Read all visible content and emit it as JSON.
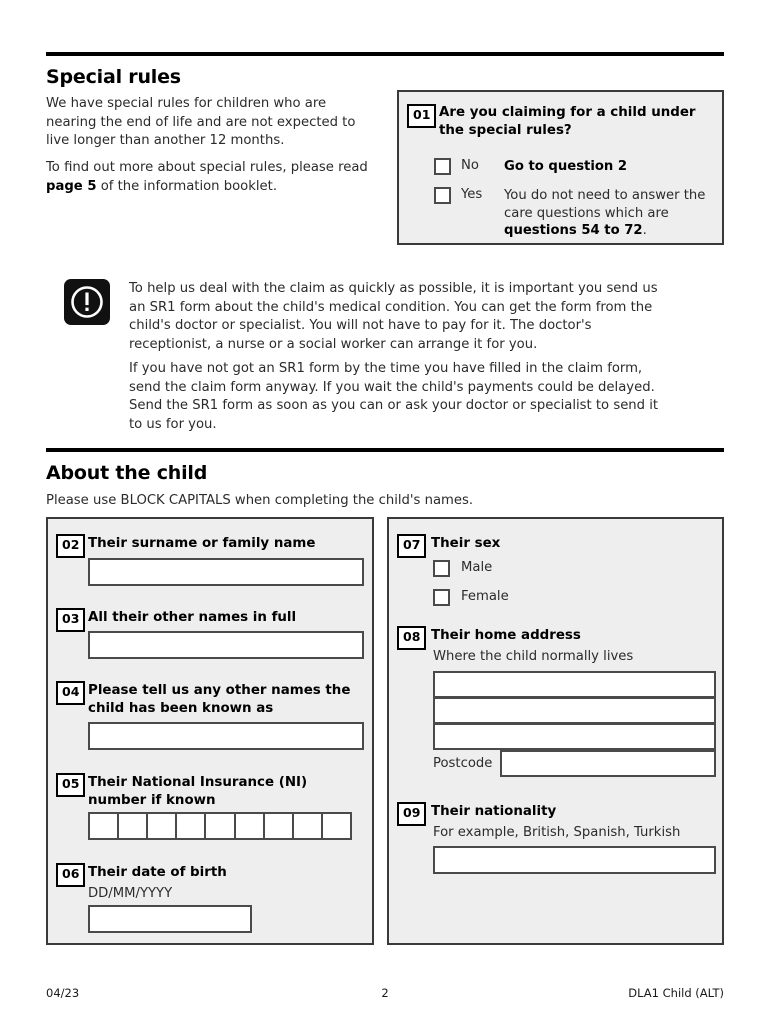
{
  "document": {
    "form_code": "DLA1 Child (ALT)",
    "page_number": "2",
    "revision_date": "04/23"
  },
  "section_special_rules": {
    "heading": "Special rules",
    "paragraph_1": "We have special rules for children who are nearing the end of life and are not expected to live longer than another 12 months.",
    "paragraph_2_before": "To find out more about special rules, please read ",
    "paragraph_2_bold": "page 5",
    "paragraph_2_after": " of the information booklet."
  },
  "question_01": {
    "number": "01",
    "label": "Are you claiming for a child under the special rules?",
    "options": [
      {
        "checkbox_label": "No",
        "note_text": "Go to question 2",
        "note_bold": true
      },
      {
        "checkbox_label": "Yes",
        "note_before": "You do not need to answer the care questions which are ",
        "note_bold_text": "questions 54 to 72",
        "note_after": "."
      }
    ]
  },
  "notice": {
    "icon": "exclamation-mark-icon",
    "paragraph_1": "To help us deal with the claim as quickly as possible, it is important you send us an SR1 form about the child's medical condition. You can get the form from the child's doctor or specialist. You will not have to pay for it. The doctor's receptionist, a nurse or a social worker can arrange it for you.",
    "paragraph_2": "If you have not got an SR1 form by the time you have filled in the claim form, send the claim form anyway. If you wait the child's payments could be delayed. Send the SR1 form as soon as you can or ask your doctor or specialist to send it to us for you."
  },
  "section_about_child": {
    "heading": "About the child",
    "instruction": "Please use BLOCK CAPITALS when completing the child's names."
  },
  "question_02": {
    "number": "02",
    "label": "Their surname or family name",
    "value": ""
  },
  "question_03": {
    "number": "03",
    "label": "All their other names in full",
    "value": ""
  },
  "question_04": {
    "number": "04",
    "label": "Please tell us any other names the child has been known as",
    "value": ""
  },
  "question_05": {
    "number": "05",
    "label": "Their National Insurance (NI) number if known",
    "cell_count": 9,
    "value": ""
  },
  "question_06": {
    "number": "06",
    "label": "Their date of birth",
    "format_hint": "DD/MM/YYYY",
    "value": ""
  },
  "question_07": {
    "number": "07",
    "label": "Their sex",
    "options": [
      "Male",
      "Female"
    ]
  },
  "question_08": {
    "number": "08",
    "label": "Their home address",
    "sublabel": "Where the child normally lives",
    "address_line_1": "",
    "address_line_2": "",
    "address_line_3": "",
    "postcode_label": "Postcode",
    "postcode_value": ""
  },
  "question_09": {
    "number": "09",
    "label": "Their nationality",
    "sublabel": "For example, British, Spanish, Turkish",
    "value": ""
  },
  "colors": {
    "panel_background": "#eeeeee",
    "border": "#3a3a3a",
    "field_border": "#4a4a4a",
    "rule": "#000000",
    "text": "#2b2b2b"
  }
}
